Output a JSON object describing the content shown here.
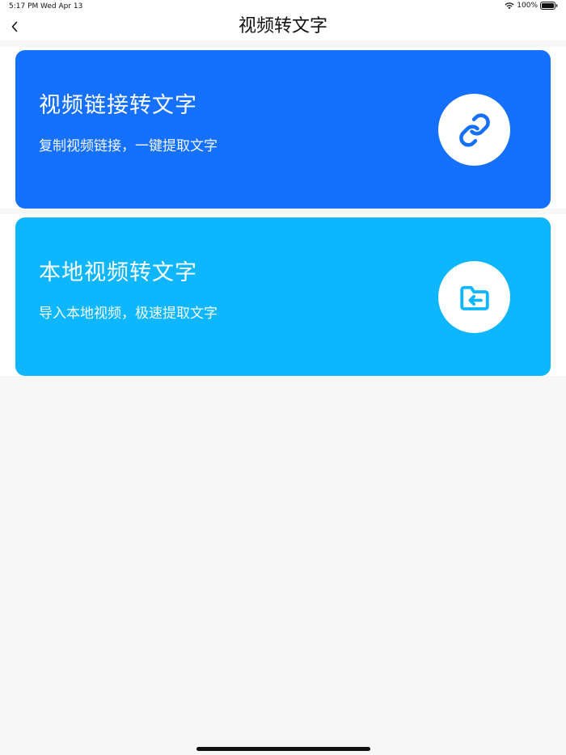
{
  "status_bar": {
    "time": "5:17 PM",
    "date": "Wed Apr 13",
    "battery": "100%"
  },
  "nav": {
    "title": "视频转文字",
    "back_icon": "chevron-left-icon"
  },
  "cards": [
    {
      "title": "视频链接转文字",
      "subtitle": "复制视频链接，一键提取文字",
      "icon": "link-icon",
      "color": "#1570fd",
      "icon_color": "#1570fd"
    },
    {
      "title": "本地视频转文字",
      "subtitle": "导入本地视频，极速提取文字",
      "icon": "folder-import-icon",
      "color": "#0eb6fe",
      "icon_color": "#0eb6fe"
    }
  ],
  "colors": {
    "background": "#f7f7f7",
    "surface": "#ffffff",
    "text": "#111111"
  }
}
